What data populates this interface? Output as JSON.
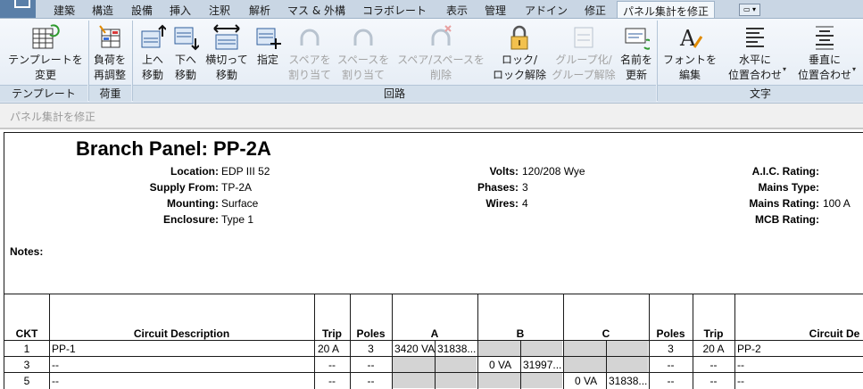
{
  "tabs": [
    "建築",
    "構造",
    "設備",
    "挿入",
    "注釈",
    "解析",
    "マス & 外構",
    "コラボレート",
    "表示",
    "管理",
    "アドイン",
    "修正",
    "パネル集計を修正"
  ],
  "tab_dropdown": "▭ ▾",
  "ribbon": {
    "buttons": [
      {
        "line1": "テンプレートを",
        "line2": "変更",
        "icon": "template-table-icon",
        "enabled": true
      },
      {
        "line1": "負荷を",
        "line2": "再調整",
        "icon": "rebalance-loads-icon",
        "enabled": true
      },
      {
        "line1": "上へ",
        "line2": "移動",
        "icon": "move-up-icon",
        "enabled": true
      },
      {
        "line1": "下へ",
        "line2": "移動",
        "icon": "move-down-icon",
        "enabled": true
      },
      {
        "line1": "横切って",
        "line2": "移動",
        "icon": "move-across-icon",
        "enabled": true
      },
      {
        "line1": "指定",
        "line2": "",
        "icon": "assign-icon",
        "enabled": true
      },
      {
        "line1": "スペアを",
        "line2": "割り当て",
        "icon": "assign-spare-icon",
        "enabled": false
      },
      {
        "line1": "スペースを",
        "line2": "割り当て",
        "icon": "assign-space-icon",
        "enabled": false
      },
      {
        "line1": "スペア/スペースを",
        "line2": "削除",
        "icon": "remove-spare-icon",
        "enabled": false
      },
      {
        "line1": "ロック/",
        "line2": "ロック解除",
        "icon": "lock-icon",
        "enabled": true
      },
      {
        "line1": "グループ化/",
        "line2": "グループ解除",
        "icon": "group-icon",
        "enabled": false
      },
      {
        "line1": "名前を",
        "line2": "更新",
        "icon": "update-names-icon",
        "enabled": true
      },
      {
        "line1": "フォントを",
        "line2": "編集",
        "icon": "font-icon",
        "enabled": true
      },
      {
        "line1": "水平に",
        "line2": "位置合わせ",
        "icon": "align-horizontal-icon",
        "enabled": true
      },
      {
        "line1": "垂直に",
        "line2": "位置合わせ",
        "icon": "align-vertical-icon",
        "enabled": true
      }
    ],
    "groups": [
      "テンプレート",
      "荷重",
      "回路",
      "文字"
    ]
  },
  "context_label": "パネル集計を修正",
  "panel": {
    "title": "Branch Panel: PP-2A",
    "left": [
      {
        "label": "Location:",
        "value": "EDP III 52"
      },
      {
        "label": "Supply From:",
        "value": "TP-2A"
      },
      {
        "label": "Mounting:",
        "value": "Surface"
      },
      {
        "label": "Enclosure:",
        "value": "Type 1"
      }
    ],
    "middle": [
      {
        "label": "Volts:",
        "value": "120/208 Wye"
      },
      {
        "label": "Phases:",
        "value": "3"
      },
      {
        "label": "Wires:",
        "value": "4"
      }
    ],
    "right": [
      {
        "label": "A.I.C. Rating:",
        "value": ""
      },
      {
        "label": "Mains Type:",
        "value": ""
      },
      {
        "label": "Mains Rating:",
        "value": "100 A"
      },
      {
        "label": "MCB Rating:",
        "value": ""
      }
    ],
    "notes_label": "Notes:"
  },
  "table": {
    "headers": {
      "ckt": "CKT",
      "desc": "Circuit Description",
      "trip": "Trip",
      "poles": "Poles",
      "a": "A",
      "b": "B",
      "c": "C",
      "poles_r": "Poles",
      "trip_r": "Trip",
      "desc_r": "Circuit De"
    },
    "rows": [
      {
        "ckt": "1",
        "desc": "PP-1",
        "trip": "20 A",
        "poles": "3",
        "a1": "3420 VA",
        "a2": "31838...",
        "b1": "",
        "b2": "",
        "c1": "",
        "c2": "",
        "poles_r": "3",
        "trip_r": "20 A",
        "desc_r": "PP-2"
      },
      {
        "ckt": "3",
        "desc": "--",
        "trip": "--",
        "poles": "--",
        "a1": "",
        "a2": "",
        "b1": "0 VA",
        "b2": "31997...",
        "c1": "",
        "c2": "",
        "poles_r": "--",
        "trip_r": "--",
        "desc_r": "--"
      },
      {
        "ckt": "5",
        "desc": "--",
        "trip": "--",
        "poles": "--",
        "a1": "",
        "a2": "",
        "b1": "",
        "b2": "",
        "c1": "0 VA",
        "c2": "31838...",
        "poles_r": "--",
        "trip_r": "--",
        "desc_r": "--"
      }
    ]
  }
}
